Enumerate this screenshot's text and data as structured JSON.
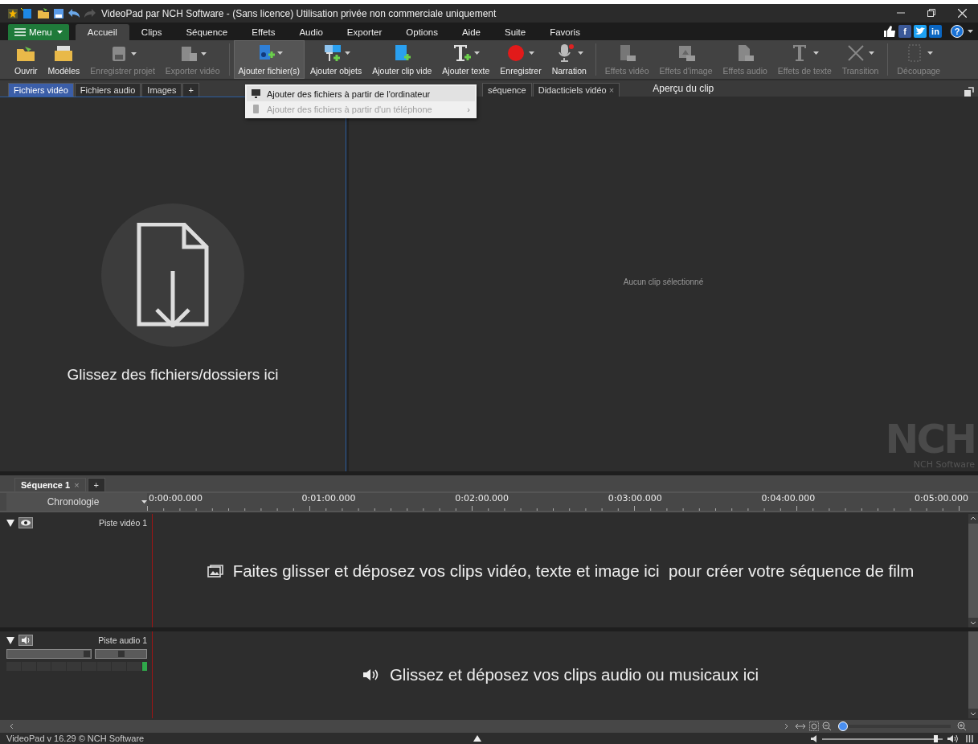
{
  "window": {
    "title": "VideoPad par NCH Software - (Sans licence) Utilisation privée non commerciale uniquement"
  },
  "menu": {
    "button": "Menu",
    "tabs": [
      {
        "label": "Accueil",
        "selected": true
      },
      {
        "label": "Clips",
        "selected": false
      },
      {
        "label": "Séquence",
        "selected": false
      },
      {
        "label": "Effets",
        "selected": false
      },
      {
        "label": "Audio",
        "selected": false
      },
      {
        "label": "Exporter",
        "selected": false
      },
      {
        "label": "Options",
        "selected": false
      },
      {
        "label": "Aide",
        "selected": false
      },
      {
        "label": "Suite",
        "selected": false
      },
      {
        "label": "Favoris",
        "selected": false
      }
    ],
    "social": [
      {
        "kind": "like"
      },
      {
        "kind": "facebook",
        "label": "f"
      },
      {
        "kind": "twitter"
      },
      {
        "kind": "linkedin",
        "label": "in"
      }
    ],
    "help": "?"
  },
  "toolbar": [
    {
      "label": "Ouvrir",
      "kind": "folder",
      "disabled": false,
      "pressed": false,
      "dropdown": false
    },
    {
      "label": "Modèles",
      "kind": "templates",
      "disabled": false,
      "pressed": false,
      "dropdown": false
    },
    {
      "label": "Enregistrer projet",
      "kind": "save",
      "disabled": true,
      "pressed": false,
      "dropdown": true
    },
    {
      "label": "Exporter vidéo",
      "kind": "export",
      "disabled": true,
      "pressed": false,
      "dropdown": true,
      "separator": true
    },
    {
      "label": "Ajouter fichier(s)",
      "kind": "addfile",
      "disabled": false,
      "pressed": true,
      "dropdown": true
    },
    {
      "label": "Ajouter objets",
      "kind": "objects",
      "disabled": false,
      "pressed": false,
      "dropdown": true
    },
    {
      "label": "Ajouter clip vide",
      "kind": "blank",
      "disabled": false,
      "pressed": false,
      "dropdown": false
    },
    {
      "label": "Ajouter texte",
      "kind": "text",
      "disabled": false,
      "pressed": false,
      "dropdown": true
    },
    {
      "label": "Enregistrer",
      "kind": "record",
      "disabled": false,
      "pressed": false,
      "dropdown": true
    },
    {
      "label": "Narration",
      "kind": "mic",
      "disabled": false,
      "pressed": false,
      "dropdown": true,
      "separator": true
    },
    {
      "label": "Effets vidéo",
      "kind": "fxvideo",
      "disabled": true,
      "pressed": false,
      "dropdown": false
    },
    {
      "label": "Effets d'image",
      "kind": "fximage",
      "disabled": true,
      "pressed": false,
      "dropdown": false
    },
    {
      "label": "Effets audio",
      "kind": "fxaudio",
      "disabled": true,
      "pressed": false,
      "dropdown": false
    },
    {
      "label": "Effets de texte",
      "kind": "fxtext",
      "disabled": true,
      "pressed": false,
      "dropdown": true
    },
    {
      "label": "Transition",
      "kind": "transition",
      "disabled": true,
      "pressed": false,
      "dropdown": true,
      "separator": true
    },
    {
      "label": "Découpage",
      "kind": "crop",
      "disabled": true,
      "pressed": false,
      "dropdown": true
    }
  ],
  "dropdown_menu": [
    {
      "label": "Ajouter des fichiers à partir de l'ordinateur",
      "disabled": false,
      "kind": "monitor"
    },
    {
      "label": "Ajouter des fichiers à partir d'un téléphone",
      "disabled": true,
      "submenu": "›",
      "kind": "phone"
    }
  ],
  "bin_tabs": [
    {
      "label": "Fichiers vidéo",
      "selected": true
    },
    {
      "label": "Fichiers audio",
      "selected": false
    },
    {
      "label": "Images",
      "selected": false
    },
    {
      "label": "+",
      "selected": false
    }
  ],
  "bin": {
    "drop_hint": "Glissez des fichiers/dossiers ici"
  },
  "preview_tabs": [
    {
      "label": "séquence"
    },
    {
      "label": "Didacticiels vidéo",
      "close": "×"
    }
  ],
  "preview": {
    "title": "Aperçu du clip",
    "message": "Aucun clip sélectionné",
    "logo": "NCH",
    "logo_caption": "NCH Software"
  },
  "sequence_tabs": [
    {
      "label": "Séquence 1",
      "close": "×",
      "selected": true
    },
    {
      "label": "+",
      "selected": false
    }
  ],
  "timeline": {
    "mode": "Chronologie",
    "ticks": [
      "0:00:00.000",
      "0:01:00.000",
      "0:02:00.000",
      "0:03:00.000",
      "0:04:00.000",
      "0:05:00.000"
    ]
  },
  "video_track": {
    "name": "Piste vidéo 1",
    "expanded": true,
    "hint": "Faites glisser et déposez vos clips vidéo, texte et image ici  pour créer votre séquence de film"
  },
  "audio_track": {
    "name": "Piste audio 1",
    "expanded": true,
    "volume": {
      "level": 0.95
    },
    "pan": {
      "level": 0.5
    },
    "hint": "Glissez et déposez vos clips audio ou musicaux ici"
  },
  "zoom": {
    "level": 0.0
  },
  "status_bar": {
    "version": "VideoPad v 16.29 © NCH Software",
    "volume": {
      "level": 0.96
    }
  }
}
